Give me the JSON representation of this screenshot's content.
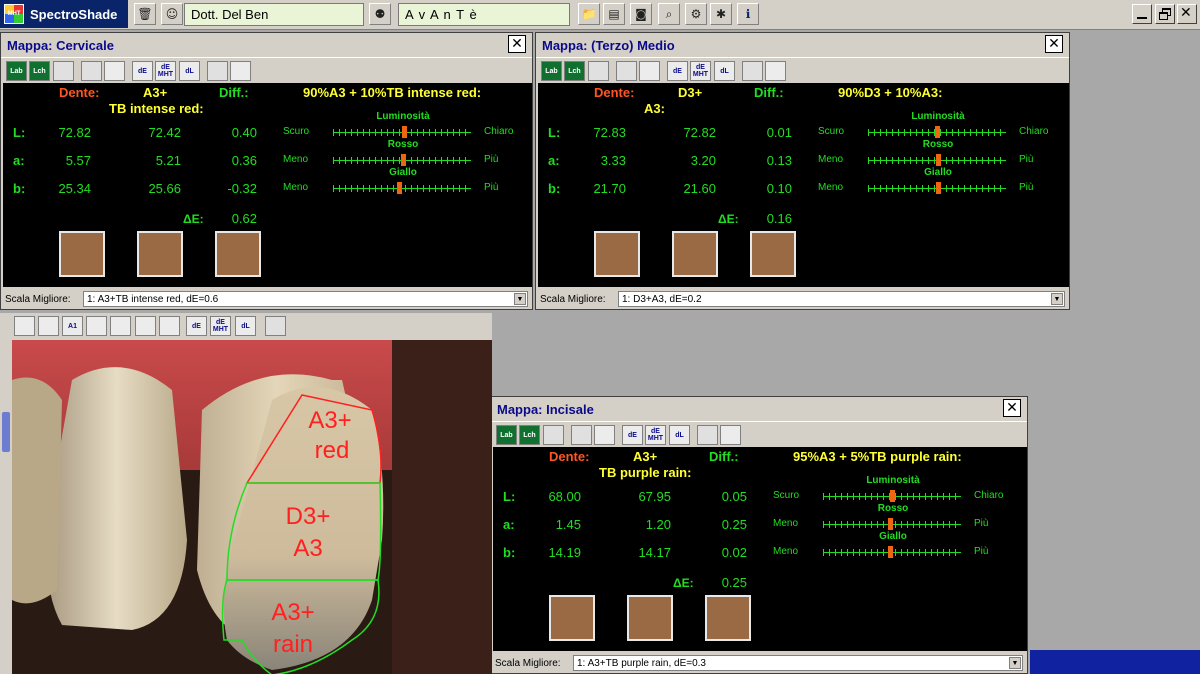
{
  "app": {
    "name": "SpectroShade",
    "logo_mark": "MHT",
    "doctor": "Dott. Del Ben",
    "patient": "A v A n T è"
  },
  "toolbar_icons": [
    "trash-icon",
    "doctor-icon",
    "patients-icon",
    "folder-icon",
    "document-icon",
    "camera-icon",
    "search-icon",
    "settings-icon",
    "tools-icon",
    "info-icon"
  ],
  "windows": [
    {
      "id": "cervicale",
      "title": "Mappa: Cervicale",
      "headers": {
        "dente": "Dente:",
        "shade_line1": "A3+",
        "shade_line2": "TB intense red:",
        "diff": "Diff.:",
        "mix": "90%A3 + 10%TB intense red:"
      },
      "rows": [
        {
          "label": "L:",
          "dente": "72.82",
          "shade": "72.42",
          "diff": "0.40",
          "left": "Scuro",
          "right": "Chiaro",
          "slider_title": "Luminosità",
          "slider_pos": 0.52
        },
        {
          "label": "a:",
          "dente": "5.57",
          "shade": "5.21",
          "diff": "0.36",
          "left": "Meno",
          "right": "Più",
          "slider_title": "Rosso",
          "slider_pos": 0.51
        },
        {
          "label": "b:",
          "dente": "25.34",
          "shade": "25.66",
          "diff": "-0.32",
          "left": "Meno",
          "right": "Più",
          "slider_title": "Giallo",
          "slider_pos": 0.48
        }
      ],
      "de_label": "ΔE:",
      "de_value": "0.62",
      "scala_label": "Scala Migliore:",
      "scala_value": "1: A3+TB intense red, dE=0.6"
    },
    {
      "id": "medio",
      "title": "Mappa: (Terzo) Medio",
      "headers": {
        "dente": "Dente:",
        "shade_line1": "D3+",
        "shade_line2": "A3:",
        "diff": "Diff.:",
        "mix": "90%D3 + 10%A3:"
      },
      "rows": [
        {
          "label": "L:",
          "dente": "72.83",
          "shade": "72.82",
          "diff": "0.01",
          "left": "Scuro",
          "right": "Chiaro",
          "slider_title": "Luminosità",
          "slider_pos": 0.5
        },
        {
          "label": "a:",
          "dente": "3.33",
          "shade": "3.20",
          "diff": "0.13",
          "left": "Meno",
          "right": "Più",
          "slider_title": "Rosso",
          "slider_pos": 0.51
        },
        {
          "label": "b:",
          "dente": "21.70",
          "shade": "21.60",
          "diff": "0.10",
          "left": "Meno",
          "right": "Più",
          "slider_title": "Giallo",
          "slider_pos": 0.51
        }
      ],
      "de_label": "ΔE:",
      "de_value": "0.16",
      "scala_label": "Scala Migliore:",
      "scala_value": "1: D3+A3, dE=0.2"
    },
    {
      "id": "incisale",
      "title": "Mappa: Incisale",
      "headers": {
        "dente": "Dente:",
        "shade_line1": "A3+",
        "shade_line2": "TB purple rain:",
        "diff": "Diff.:",
        "mix": "95%A3 + 5%TB purple rain:"
      },
      "rows": [
        {
          "label": "L:",
          "dente": "68.00",
          "shade": "67.95",
          "diff": "0.05",
          "left": "Scuro",
          "right": "Chiaro",
          "slider_title": "Luminosità",
          "slider_pos": 0.5
        },
        {
          "label": "a:",
          "dente": "1.45",
          "shade": "1.20",
          "diff": "0.25",
          "left": "Meno",
          "right": "Più",
          "slider_title": "Rosso",
          "slider_pos": 0.49
        },
        {
          "label": "b:",
          "dente": "14.19",
          "shade": "14.17",
          "diff": "0.02",
          "left": "Meno",
          "right": "Più",
          "slider_title": "Giallo",
          "slider_pos": 0.49
        }
      ],
      "de_label": "ΔE:",
      "de_value": "0.25",
      "scala_label": "Scala Migliore:",
      "scala_value": "1: A3+TB purple rain, dE=0.3"
    }
  ],
  "window_tools": [
    {
      "name": "lab-button",
      "text": "Lab"
    },
    {
      "name": "lch-button",
      "text": "Lch"
    },
    {
      "name": "grid-button",
      "text": ""
    },
    {
      "name": "chart-button",
      "text": ""
    },
    {
      "name": "color-wheel-button",
      "text": ""
    },
    {
      "name": "de-button",
      "text": "dE"
    },
    {
      "name": "de-mht-button",
      "text": "dE MHT"
    },
    {
      "name": "dl-button",
      "text": "dL"
    },
    {
      "name": "add-map-button",
      "text": ""
    },
    {
      "name": "color-picker-button",
      "text": ""
    }
  ],
  "image_tools": [
    {
      "name": "tooth-outline-button",
      "text": ""
    },
    {
      "name": "tooth-shape-button",
      "text": ""
    },
    {
      "name": "a1-button",
      "text": "A1"
    },
    {
      "name": "tooth-map-button",
      "text": ""
    },
    {
      "name": "zones-button",
      "text": ""
    },
    {
      "name": "gradient-button",
      "text": ""
    },
    {
      "name": "colormap-button",
      "text": ""
    },
    {
      "name": "de-button",
      "text": "dE"
    },
    {
      "name": "de-mht-button",
      "text": "dE MHT"
    },
    {
      "name": "dl-button",
      "text": "dL"
    },
    {
      "name": "tooth-green-button",
      "text": ""
    }
  ],
  "photo_labels": {
    "top_line1": "A3+",
    "top_line2": "red",
    "mid_line1": "D3+",
    "mid_line2": "A3",
    "bot_line1": "A3+",
    "bot_line2": "rain"
  },
  "colors": {
    "title_text": "#0a0a8a",
    "data_green": "#22dd22",
    "header_red": "#ff5522",
    "header_yellow": "#ffff33",
    "slider_thumb": "#ee6611",
    "swatch": "#9a6a45",
    "zone_red": "#ff2020",
    "zone_green": "#22dd22"
  }
}
